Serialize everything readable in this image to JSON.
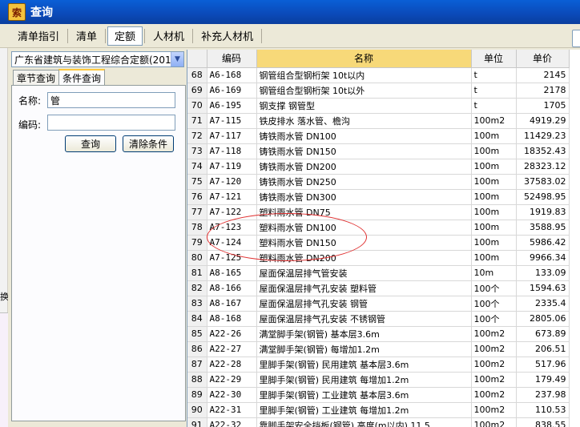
{
  "window": {
    "title": "查询"
  },
  "toolbar": {
    "items": [
      {
        "label": "清单指引",
        "active": false
      },
      {
        "label": "清单",
        "active": false
      },
      {
        "label": "定额",
        "active": true
      },
      {
        "label": "人材机",
        "active": false
      },
      {
        "label": "补充人材机",
        "active": false
      }
    ]
  },
  "left": {
    "quota_select": "广东省建筑与装饰工程综合定额(201",
    "tabs": [
      {
        "label": "章节查询",
        "active": false
      },
      {
        "label": "条件查询",
        "active": true
      }
    ],
    "name_label": "名称:",
    "name_value": "管",
    "code_label": "编码:",
    "code_value": "",
    "query_button": "查询",
    "clear_button": "清除条件",
    "strip_mark": "换"
  },
  "table": {
    "headers": [
      "",
      "编码",
      "名称",
      "单位",
      "单价"
    ],
    "rows": [
      [
        "68",
        "A6-168",
        "钢管组合型钢桁架 10t以内",
        "t",
        "2145"
      ],
      [
        "69",
        "A6-169",
        "钢管组合型钢桁架 10t以外",
        "t",
        "2178"
      ],
      [
        "70",
        "A6-195",
        "钢支撑 钢管型",
        "t",
        "1705"
      ],
      [
        "71",
        "A7-115",
        "铁皮排水 落水管、檐沟",
        "100m2",
        "4919.29"
      ],
      [
        "72",
        "A7-117",
        "铸铁雨水管 DN100",
        "100m",
        "11429.23"
      ],
      [
        "73",
        "A7-118",
        "铸铁雨水管 DN150",
        "100m",
        "18352.43"
      ],
      [
        "74",
        "A7-119",
        "铸铁雨水管 DN200",
        "100m",
        "28323.12"
      ],
      [
        "75",
        "A7-120",
        "铸铁雨水管 DN250",
        "100m",
        "37583.02"
      ],
      [
        "76",
        "A7-121",
        "铸铁雨水管 DN300",
        "100m",
        "52498.95"
      ],
      [
        "77",
        "A7-122",
        "塑料雨水管 DN75",
        "100m",
        "1919.83"
      ],
      [
        "78",
        "A7-123",
        "塑料雨水管 DN100",
        "100m",
        "3588.95"
      ],
      [
        "79",
        "A7-124",
        "塑料雨水管 DN150",
        "100m",
        "5986.42"
      ],
      [
        "80",
        "A7-125",
        "塑料雨水管 DN200",
        "100m",
        "9966.34"
      ],
      [
        "81",
        "A8-165",
        "屋面保温层排气管安装",
        "10m",
        "133.09"
      ],
      [
        "82",
        "A8-166",
        "屋面保温层排气孔安装 塑料管",
        "100个",
        "1594.63"
      ],
      [
        "83",
        "A8-167",
        "屋面保温层排气孔安装 钢管",
        "100个",
        "2335.4"
      ],
      [
        "84",
        "A8-168",
        "屋面保温层排气孔安装 不锈钢管",
        "100个",
        "2805.06"
      ],
      [
        "85",
        "A22-26",
        "满堂脚手架(钢管) 基本层3.6m",
        "100m2",
        "673.89"
      ],
      [
        "86",
        "A22-27",
        "满堂脚手架(钢管) 每增加1.2m",
        "100m2",
        "206.51"
      ],
      [
        "87",
        "A22-28",
        "里脚手架(钢管) 民用建筑 基本层3.6m",
        "100m2",
        "517.96"
      ],
      [
        "88",
        "A22-29",
        "里脚手架(钢管) 民用建筑 每增加1.2m",
        "100m2",
        "179.49"
      ],
      [
        "89",
        "A22-30",
        "里脚手架(钢管) 工业建筑 基本层3.6m",
        "100m2",
        "237.98"
      ],
      [
        "90",
        "A22-31",
        "里脚手架(钢管) 工业建筑 每增加1.2m",
        "100m2",
        "110.53"
      ],
      [
        "91",
        "A22-32",
        "靠脚手架安全挡板(钢管) 高度(m以内) 11.5",
        "100m2",
        "838.55"
      ]
    ]
  }
}
